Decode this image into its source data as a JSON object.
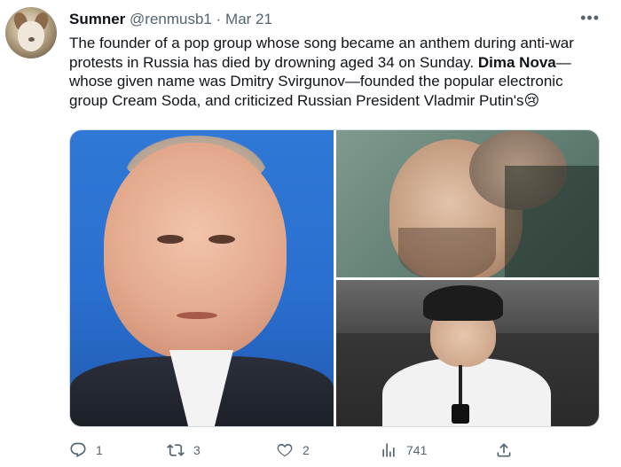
{
  "author": {
    "name": "Sumner",
    "handle": "@renmusb1",
    "separator": "·",
    "date": "Mar 21"
  },
  "tweet": {
    "text_part1": "The founder of a pop group whose song became an anthem during anti-war protests in Russia has died by drowning aged 34 on Sunday. ",
    "text_bold": "Dima Nova",
    "text_part2": "—whose given name was Dmitry Svirgunov—founded the popular electronic group Cream Soda, and criticized Russian President Vladmir Putin's",
    "emoji": "😢"
  },
  "actions": {
    "replies": "1",
    "retweets": "3",
    "likes": "2",
    "views": "741"
  },
  "more_label": "•••",
  "colors": {
    "primary_text": "#0f1419",
    "secondary_text": "#536471",
    "border": "#cfd9de"
  },
  "icons": {
    "reply": "reply-icon",
    "retweet": "retweet-icon",
    "like": "heart-icon",
    "views": "views-icon",
    "share": "share-icon",
    "more": "more-icon"
  }
}
